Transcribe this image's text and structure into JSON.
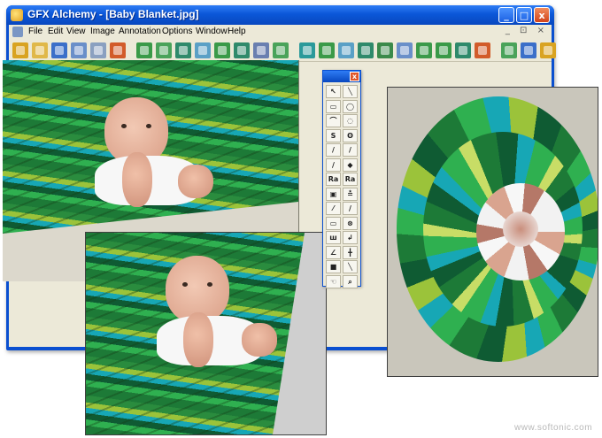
{
  "window": {
    "title": "GFX Alchemy - [Baby Blanket.jpg]",
    "minimize": "_",
    "maximize": "□",
    "close": "x"
  },
  "menu": [
    {
      "label": "File"
    },
    {
      "label": "Edit"
    },
    {
      "label": "View"
    },
    {
      "label": "Image"
    },
    {
      "label": "Annotation"
    },
    {
      "label": "Options"
    },
    {
      "label": "Window"
    },
    {
      "label": "Help"
    }
  ],
  "mdi_controls": "_ ⊡ ×",
  "toolbar_icons": [
    "new-icon",
    "open-icon",
    "save-icon",
    "print-icon",
    "print-preview-icon",
    "undo-icon",
    "filter-icon",
    "filter-icon",
    "filter-icon",
    "filter-icon",
    "filter-icon",
    "filter-icon",
    "filter-icon",
    "filter-icon",
    "transform-icon",
    "transform-icon",
    "transform-icon",
    "transform-icon",
    "crop-icon",
    "resize-icon",
    "rotate-icon",
    "resize-icon",
    "arrow-icon",
    "lock-icon",
    "image-icon",
    "window-icon",
    "help-icon"
  ],
  "tool_palette": {
    "close": "x",
    "tools": [
      {
        "icon": "pointer-icon",
        "glyph": "↖"
      },
      {
        "icon": "line-icon",
        "glyph": "╲"
      },
      {
        "icon": "rectangle-icon",
        "glyph": "▭"
      },
      {
        "icon": "ellipse-icon",
        "glyph": "◯"
      },
      {
        "icon": "polygon-icon",
        "glyph": "⌒"
      },
      {
        "icon": "freeform-icon",
        "glyph": "◌"
      },
      {
        "icon": "curve-icon",
        "glyph": "S"
      },
      {
        "icon": "lasso-icon",
        "glyph": "ʘ"
      },
      {
        "icon": "pencil-icon",
        "glyph": "/"
      },
      {
        "icon": "highlighter-icon",
        "glyph": "/"
      },
      {
        "icon": "brush-icon",
        "glyph": "∕"
      },
      {
        "icon": "fill-icon",
        "glyph": "◆"
      },
      {
        "icon": "text-icon",
        "glyph": "Ra"
      },
      {
        "icon": "text-color-icon",
        "glyph": "Ra"
      },
      {
        "icon": "image-icon",
        "glyph": "▣"
      },
      {
        "icon": "stamp-icon",
        "glyph": "≛"
      },
      {
        "icon": "eyedropper-icon",
        "glyph": "⁄"
      },
      {
        "icon": "airbrush-icon",
        "glyph": "∕"
      },
      {
        "icon": "eraser-icon",
        "glyph": "▭"
      },
      {
        "icon": "clone-icon",
        "glyph": "⊗"
      },
      {
        "icon": "ruler-icon",
        "glyph": "ш"
      },
      {
        "icon": "smudge-icon",
        "glyph": "↲"
      },
      {
        "icon": "angle-icon",
        "glyph": "∠"
      },
      {
        "icon": "crosshair-icon",
        "glyph": "╋"
      },
      {
        "icon": "color-swatch-icon",
        "glyph": "■"
      },
      {
        "icon": "slash-icon",
        "glyph": "╲"
      },
      {
        "icon": "hand-icon",
        "glyph": "☜"
      },
      {
        "icon": "zoom-icon",
        "glyph": "⌕"
      }
    ]
  },
  "colors": {
    "title_bar": "#0a4fd0",
    "window_face": "#ece9d8",
    "hammock_green": "#1d7a37",
    "hammock_teal": "#17a7b5",
    "hammock_lime": "#9bc33a"
  },
  "watermark": "www.softonic.com"
}
